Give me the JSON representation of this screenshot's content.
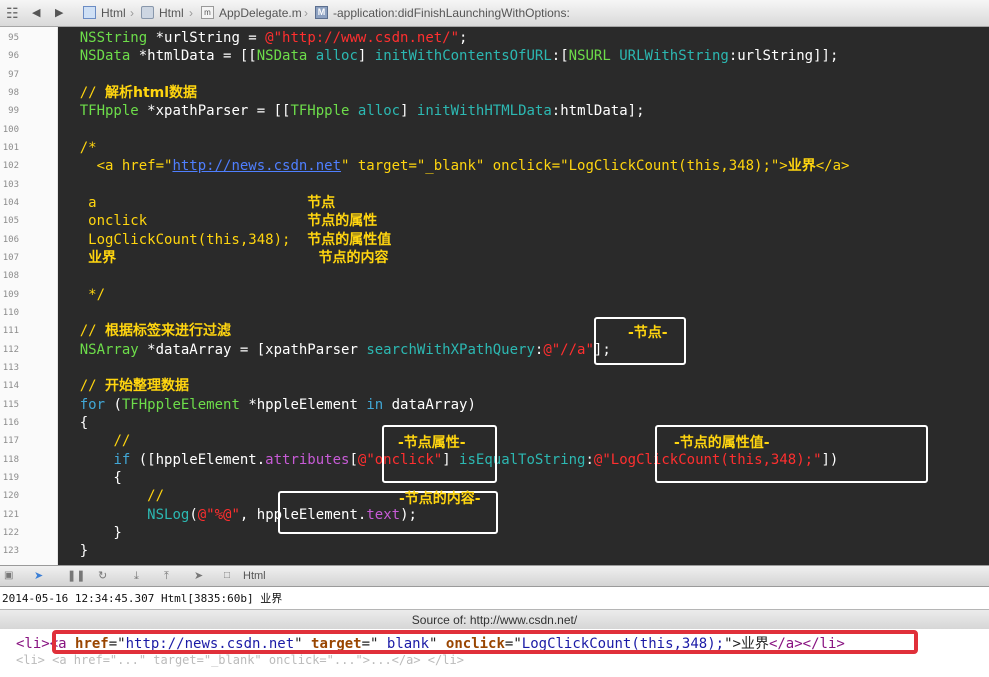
{
  "jump_bar": {
    "crumbs": [
      {
        "label": "Html",
        "icon": "project-icon"
      },
      {
        "label": "Html",
        "icon": "folder-icon"
      },
      {
        "label": "AppDelegate.m",
        "icon": "m-file-icon"
      },
      {
        "label": "-application:didFinishLaunchingWithOptions:",
        "icon": "method-icon",
        "badge": "M"
      }
    ]
  },
  "editor": {
    "line_numbers": [
      "95",
      "96",
      "97",
      "98",
      "99",
      "100",
      "101",
      "102",
      "103",
      "104",
      "105",
      "106",
      "107",
      "108",
      "109",
      "110",
      "111",
      "112",
      "113",
      "114",
      "115",
      "116",
      "117",
      "118",
      "119",
      "120",
      "121",
      "122",
      "123"
    ],
    "lines": [
      {
        "t": "    NSString *urlString = @\"http://www.csdn.net/\";",
        "segs": [
          [
            "    ",
            ""
          ],
          [
            "NSString",
            "ty"
          ],
          [
            " *urlString = ",
            ""
          ],
          [
            "@\"http://www.csdn.net/\"",
            "st"
          ],
          [
            ";",
            ""
          ]
        ]
      },
      {
        "t": "    NSData *htmlData = [[NSData alloc] initWithContentsOfURL:[NSURL URLWithString:urlString]];",
        "segs": [
          [
            "    ",
            ""
          ],
          [
            "NSData",
            "ty"
          ],
          [
            " *htmlData = [[",
            ""
          ],
          [
            "NSData",
            "ty"
          ],
          [
            " ",
            ""
          ],
          [
            "alloc",
            "me"
          ],
          [
            "] ",
            ""
          ],
          [
            "initWithContentsOfURL",
            "me"
          ],
          [
            ":[",
            ""
          ],
          [
            "NSURL",
            "ty"
          ],
          [
            " ",
            ""
          ],
          [
            "URLWithString",
            "me"
          ],
          [
            ":urlString]];",
            ""
          ]
        ]
      },
      {
        "t": "",
        "segs": []
      },
      {
        "t": "    // 解析html数据",
        "segs": [
          [
            "    ",
            ""
          ],
          [
            "// ",
            "cm"
          ],
          [
            "解析html数据",
            "cjk"
          ]
        ]
      },
      {
        "t": "    TFHpple *xpathParser = [[TFHpple alloc] initWithHTMLData:htmlData];",
        "segs": [
          [
            "    ",
            ""
          ],
          [
            "TFHpple",
            "ty"
          ],
          [
            " *xpathParser = [[",
            ""
          ],
          [
            "TFHpple",
            "ty"
          ],
          [
            " ",
            ""
          ],
          [
            "alloc",
            "me"
          ],
          [
            "] ",
            ""
          ],
          [
            "initWithHTMLData",
            "me"
          ],
          [
            ":htmlData];",
            ""
          ]
        ]
      },
      {
        "t": "",
        "segs": []
      },
      {
        "t": "    /*",
        "segs": [
          [
            "    ",
            ""
          ],
          [
            "/*",
            "cm"
          ]
        ]
      },
      {
        "t": "      <a href=\"http://news.csdn.net\" target=\"_blank\" onclick=\"LogClickCount(this,348);\">业界</a>",
        "segs": [
          [
            "      <a href=\"",
            "cm"
          ],
          [
            "http://news.csdn.net",
            "url"
          ],
          [
            "\" target=\"_blank\" onclick=\"LogClickCount(this,348);\">",
            "cm"
          ],
          [
            "业界",
            "cjk"
          ],
          [
            "</a>",
            "cm"
          ]
        ]
      },
      {
        "t": "",
        "segs": []
      },
      {
        "t": "     a                         节点",
        "segs": [
          [
            "     a                         ",
            "cm"
          ],
          [
            "节点",
            "cjk"
          ]
        ]
      },
      {
        "t": "     onclick                   节点的属性",
        "segs": [
          [
            "     onclick                   ",
            "cm"
          ],
          [
            "节点的属性",
            "cjk"
          ]
        ]
      },
      {
        "t": "     LogClickCount(this,348);  节点的属性值",
        "segs": [
          [
            "     LogClickCount(this,348);  ",
            "cm"
          ],
          [
            "节点的属性值",
            "cjk"
          ]
        ]
      },
      {
        "t": "     业界                        节点的内容",
        "segs": [
          [
            "     ",
            "cm"
          ],
          [
            "业界",
            "cjk"
          ],
          [
            "                        ",
            "cm"
          ],
          [
            "节点的内容",
            "cjk"
          ]
        ]
      },
      {
        "t": "",
        "segs": []
      },
      {
        "t": "     */",
        "segs": [
          [
            "     */",
            "cm"
          ]
        ]
      },
      {
        "t": "",
        "segs": []
      },
      {
        "t": "    // 根据标签来进行过滤",
        "segs": [
          [
            "    ",
            ""
          ],
          [
            "// ",
            "cm"
          ],
          [
            "根据标签来进行过滤",
            "cjk"
          ]
        ]
      },
      {
        "t": "    NSArray *dataArray = [xpathParser searchWithXPathQuery:@\"//a\"];",
        "segs": [
          [
            "    ",
            ""
          ],
          [
            "NSArray",
            "ty"
          ],
          [
            " *dataArray = [xpathParser ",
            ""
          ],
          [
            "searchWithXPathQuery",
            "me"
          ],
          [
            ":",
            ""
          ],
          [
            "@\"//a\"",
            "st"
          ],
          [
            "];",
            ""
          ]
        ]
      },
      {
        "t": "",
        "segs": []
      },
      {
        "t": "    // 开始整理数据",
        "segs": [
          [
            "    ",
            ""
          ],
          [
            "// ",
            "cm"
          ],
          [
            "开始整理数据",
            "cjk"
          ]
        ]
      },
      {
        "t": "    for (TFHppleElement *hppleElement in dataArray)",
        "segs": [
          [
            "    ",
            ""
          ],
          [
            "for",
            "kw"
          ],
          [
            " (",
            ""
          ],
          [
            "TFHppleElement",
            "ty"
          ],
          [
            " *hppleElement ",
            ""
          ],
          [
            "in",
            "kw"
          ],
          [
            " dataArray)",
            ""
          ]
        ]
      },
      {
        "t": "    {",
        "segs": [
          [
            "    {",
            ""
          ]
        ]
      },
      {
        "t": "        //",
        "segs": [
          [
            "        ",
            ""
          ],
          [
            "//",
            "cm"
          ]
        ]
      },
      {
        "t": "        if ([hppleElement.attributes[@\"onclick\"] isEqualToString:@\"LogClickCount(this,348);\"])",
        "segs": [
          [
            "        ",
            ""
          ],
          [
            "if",
            "kw"
          ],
          [
            " ([hppleElement.",
            ""
          ],
          [
            "attributes",
            "pr"
          ],
          [
            "[",
            ""
          ],
          [
            "@\"onclick\"",
            "st"
          ],
          [
            "] ",
            ""
          ],
          [
            "isEqualToString",
            "me"
          ],
          [
            ":",
            ""
          ],
          [
            "@\"LogClickCount(this,348);\"",
            "st"
          ],
          [
            "])",
            ""
          ]
        ]
      },
      {
        "t": "        {",
        "segs": [
          [
            "        {",
            ""
          ]
        ]
      },
      {
        "t": "            //",
        "segs": [
          [
            "            ",
            ""
          ],
          [
            "//",
            "cm"
          ]
        ]
      },
      {
        "t": "            NSLog(@\"%@\", hppleElement.text);",
        "segs": [
          [
            "            ",
            ""
          ],
          [
            "NSLog",
            "me"
          ],
          [
            "(",
            ""
          ],
          [
            "@\"%@\"",
            "st"
          ],
          [
            ", hppleElement.",
            ""
          ],
          [
            "text",
            "pr"
          ],
          [
            ");",
            ""
          ]
        ]
      },
      {
        "t": "        }",
        "segs": [
          [
            "        }",
            ""
          ]
        ]
      },
      {
        "t": "    }",
        "segs": [
          [
            "    }",
            ""
          ]
        ]
      }
    ],
    "annotations": {
      "node": "-节点-",
      "attr_name": "-节点属性-",
      "attr_value": "-节点的属性值-",
      "content": "-节点的内容-"
    }
  },
  "debug_bar": {
    "target": "Html"
  },
  "console": {
    "log_line": "2014-05-16 12:34:45.307 Html[3835:60b] 业界"
  },
  "source_panel": {
    "title": "Source of: http://www.csdn.net/",
    "segs": [
      [
        "<li>",
        "tg"
      ],
      [
        "<a ",
        "tg"
      ],
      [
        "href",
        "at"
      ],
      [
        "=\"",
        ""
      ],
      [
        "http://news.csdn.net",
        "av"
      ],
      [
        "\" ",
        ""
      ],
      [
        "target",
        "at"
      ],
      [
        "=\"",
        ""
      ],
      [
        "_blank",
        "av"
      ],
      [
        "\" ",
        ""
      ],
      [
        "onclick",
        "at"
      ],
      [
        "=\"",
        ""
      ],
      [
        "LogClickCount(this,348);",
        "av"
      ],
      [
        "\">业界",
        ""
      ],
      [
        "</a>",
        "tg"
      ],
      [
        "</li>",
        "tg"
      ]
    ]
  }
}
